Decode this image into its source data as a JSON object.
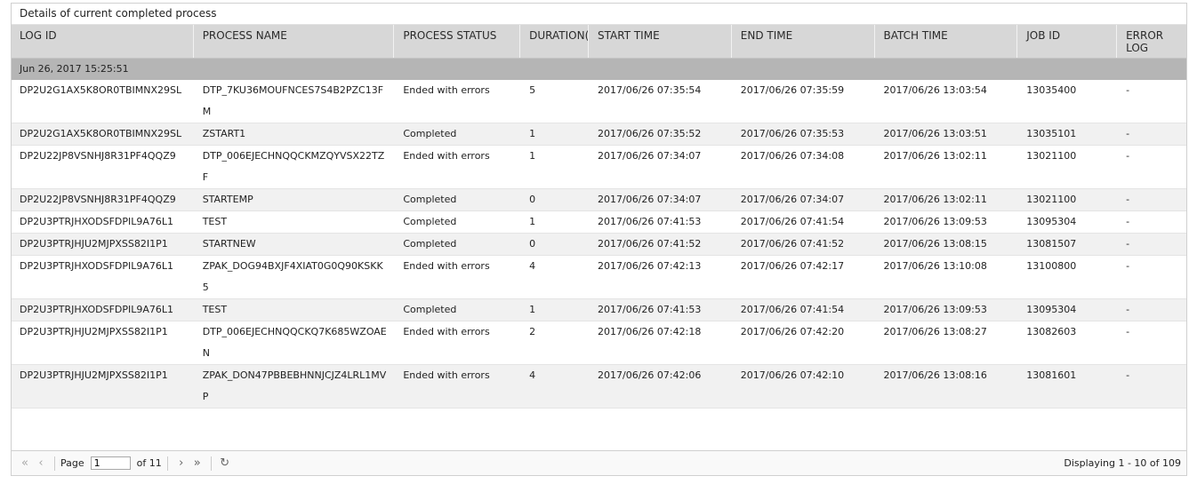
{
  "panel": {
    "title": "Details of current completed process"
  },
  "columns": [
    "LOG ID",
    "PROCESS NAME",
    "PROCESS STATUS",
    "DURATION(",
    "START TIME",
    "END TIME",
    "BATCH TIME",
    "JOB ID",
    "ERROR LOG"
  ],
  "group": {
    "label": "Jun 26, 2017 15:25:51"
  },
  "rows": [
    [
      "DP2U2G1AX5K8OR0TBIMNX29SL",
      "DTP_7KU36MOUFNCES7S4B2PZC13FM",
      "Ended with errors",
      "5",
      "2017/06/26 07:35:54",
      "2017/06/26 07:35:59",
      "2017/06/26 13:03:54",
      "13035400",
      "-"
    ],
    [
      "DP2U2G1AX5K8OR0TBIMNX29SL",
      "ZSTART1",
      "Completed",
      "1",
      "2017/06/26 07:35:52",
      "2017/06/26 07:35:53",
      "2017/06/26 13:03:51",
      "13035101",
      "-"
    ],
    [
      "DP2U22JP8VSNHJ8R31PF4QQZ9",
      "DTP_006EJECHNQQCKMZQYVSX22TZF",
      "Ended with errors",
      "1",
      "2017/06/26 07:34:07",
      "2017/06/26 07:34:08",
      "2017/06/26 13:02:11",
      "13021100",
      "-"
    ],
    [
      "DP2U22JP8VSNHJ8R31PF4QQZ9",
      "STARTEMP",
      "Completed",
      "0",
      "2017/06/26 07:34:07",
      "2017/06/26 07:34:07",
      "2017/06/26 13:02:11",
      "13021100",
      "-"
    ],
    [
      "DP2U3PTRJHXODSFDPIL9A76L1",
      "TEST",
      "Completed",
      "1",
      "2017/06/26 07:41:53",
      "2017/06/26 07:41:54",
      "2017/06/26 13:09:53",
      "13095304",
      "-"
    ],
    [
      "DP2U3PTRJHJU2MJPXSS82I1P1",
      "STARTNEW",
      "Completed",
      "0",
      "2017/06/26 07:41:52",
      "2017/06/26 07:41:52",
      "2017/06/26 13:08:15",
      "13081507",
      "-"
    ],
    [
      "DP2U3PTRJHXODSFDPIL9A76L1",
      "ZPAK_DOG94BXJF4XIAT0G0Q90KSKK5",
      "Ended with errors",
      "4",
      "2017/06/26 07:42:13",
      "2017/06/26 07:42:17",
      "2017/06/26 13:10:08",
      "13100800",
      "-"
    ],
    [
      "DP2U3PTRJHXODSFDPIL9A76L1",
      "TEST",
      "Completed",
      "1",
      "2017/06/26 07:41:53",
      "2017/06/26 07:41:54",
      "2017/06/26 13:09:53",
      "13095304",
      "-"
    ],
    [
      "DP2U3PTRJHJU2MJPXSS82I1P1",
      "DTP_006EJECHNQQCKQ7K685WZOAEN",
      "Ended with errors",
      "2",
      "2017/06/26 07:42:18",
      "2017/06/26 07:42:20",
      "2017/06/26 13:08:27",
      "13082603",
      "-"
    ],
    [
      "DP2U3PTRJHJU2MJPXSS82I1P1",
      "ZPAK_DON47PBBEBHNNJCJZ4LRL1MVP",
      "Ended with errors",
      "4",
      "2017/06/26 07:42:06",
      "2017/06/26 07:42:10",
      "2017/06/26 13:08:16",
      "13081601",
      "-"
    ]
  ],
  "pager": {
    "page_label": "Page",
    "page_value": "1",
    "of_label": "of 11",
    "display_info": "Displaying 1 - 10 of 109",
    "icons": {
      "first": "first-page-icon",
      "prev": "prev-page-icon",
      "next": "next-page-icon",
      "last": "last-page-icon",
      "refresh": "refresh-icon"
    }
  }
}
